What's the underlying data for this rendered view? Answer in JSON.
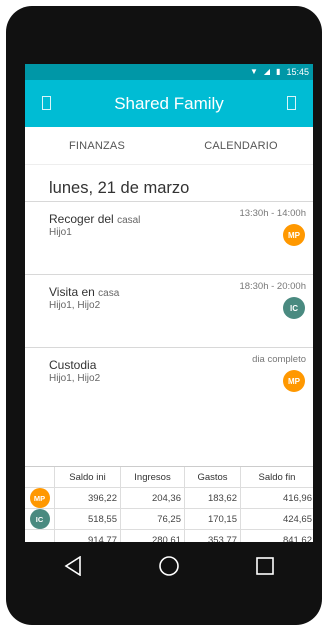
{
  "status_bar": {
    "time": "15:45",
    "icons": [
      "wifi-icon",
      "signal-icon",
      "battery-icon"
    ]
  },
  "app_bar": {
    "title": "Shared Family",
    "left_icon": "menu-icon",
    "right_icon": "calendar-icon"
  },
  "tabs": [
    {
      "label": "FINANZAS"
    },
    {
      "label": "CALENDARIO"
    }
  ],
  "date_heading": "lunes, 21 de marzo",
  "events": [
    {
      "title": "Recoger del",
      "title_small": "casal",
      "people": "Hijo1",
      "time": "13:30h - 14:00h",
      "avatar": "MP",
      "avatar_color": "#ff9800"
    },
    {
      "title": "Visita en",
      "title_small": "casa",
      "people": "Hijo1, Hijo2",
      "time": "18:30h - 20:00h",
      "avatar": "IC",
      "avatar_color": "#4a8a80"
    },
    {
      "title": "Custodia",
      "title_small": "",
      "people": "Hijo1, Hijo2",
      "time": "dia completo",
      "avatar": "MP",
      "avatar_color": "#ff9800"
    }
  ],
  "balance": {
    "headers": [
      "Saldo ini",
      "Ingresos",
      "Gastos",
      "Saldo fin"
    ],
    "rows": [
      {
        "avatar": "MP",
        "avatar_color": "#ff9800",
        "values": [
          "396,22",
          "204,36",
          "183,62",
          "416,96"
        ]
      },
      {
        "avatar": "IC",
        "avatar_color": "#4a8a80",
        "values": [
          "518,55",
          "76,25",
          "170,15",
          "424,65"
        ]
      },
      {
        "avatar": "",
        "avatar_color": "",
        "values": [
          "914,77",
          "280,61",
          "353,77",
          "841,62"
        ]
      }
    ]
  },
  "nav_bar": {
    "icons": [
      "back-icon",
      "home-icon",
      "recents-icon"
    ]
  },
  "colors": {
    "status_bar": "#0097a7",
    "app_bar": "#00bcd4",
    "avatar_mp": "#ff9800",
    "avatar_ic": "#4a8a80"
  }
}
